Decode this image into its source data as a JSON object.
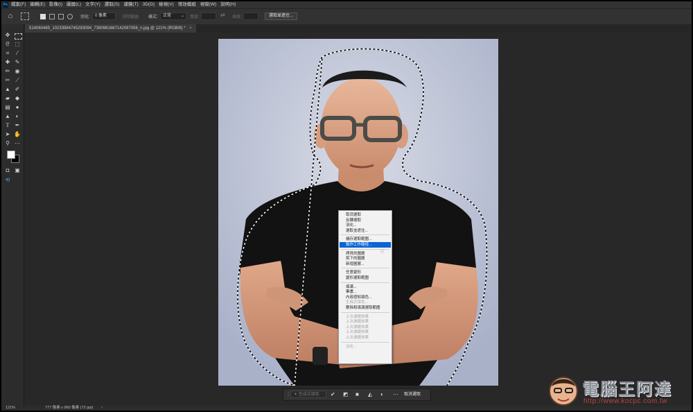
{
  "app": {
    "logo": "Ps",
    "menu": [
      "檔案(F)",
      "編輯(E)",
      "影像(I)",
      "圖層(L)",
      "文字(Y)",
      "選取(S)",
      "濾鏡(T)",
      "3D(D)",
      "檢視(V)",
      "增效模組",
      "視窗(W)",
      "說明(H)"
    ]
  },
  "options": {
    "feather_label": "羽化:",
    "feather_value": "0 像素",
    "antialias_label": "消除鋸齒",
    "style_label": "樣式:",
    "style_value": "正常",
    "width_label": "寬度:",
    "height_label": "高度:",
    "select_mask_button": "選取並遮住..."
  },
  "document": {
    "tab_title": "514060465_10233984745293094_7390961667142087056_n.jpg @ 121% (RGB/8) *"
  },
  "context_menu": {
    "items": [
      {
        "label": "取消選取",
        "disabled": false
      },
      {
        "label": "反轉選取",
        "disabled": false
      },
      {
        "label": "羽化...",
        "disabled": false
      },
      {
        "label": "選取並遮住...",
        "disabled": false
      },
      {
        "sep": true
      },
      {
        "label": "儲存選取範圍...",
        "disabled": false
      },
      {
        "label": "製作工作路徑...",
        "disabled": false,
        "highlighted": true
      },
      {
        "sep": true
      },
      {
        "label": "拷貝的圖層",
        "disabled": false
      },
      {
        "label": "剪下的圖層",
        "disabled": false
      },
      {
        "label": "新增圖層...",
        "disabled": false
      },
      {
        "sep": true
      },
      {
        "label": "任意變形",
        "disabled": false
      },
      {
        "label": "變形選取範圍",
        "disabled": false
      },
      {
        "sep": true
      },
      {
        "label": "填滿...",
        "disabled": false
      },
      {
        "label": "筆畫...",
        "disabled": false
      },
      {
        "label": "內容感知填色...",
        "disabled": false
      },
      {
        "label": "生成式填色...",
        "disabled": true
      },
      {
        "label": "刪除和填滿選取範圍",
        "disabled": false
      },
      {
        "sep": true
      },
      {
        "label": "上次濾鏡效果",
        "disabled": true
      },
      {
        "label": "上次濾鏡效果",
        "disabled": true
      },
      {
        "label": "上次濾鏡效果",
        "disabled": true
      },
      {
        "label": "上次濾鏡效果",
        "disabled": true
      },
      {
        "label": "上次濾鏡效果",
        "disabled": true
      },
      {
        "sep": true
      },
      {
        "label": "淡化...",
        "disabled": true
      }
    ]
  },
  "contextual_taskbar": {
    "generative_fill_label": "生成式填色",
    "deselect_label": "取消選取"
  },
  "status": {
    "zoom": "121%",
    "doc_info": "777 像素 x 960 像素 (72 ppi)"
  },
  "watermark": {
    "title": "電腦王阿達",
    "url": "http://www.kocpc.com.tw"
  },
  "colors": {
    "highlight": "#0a64d6",
    "foreground_swatch": "#ffffff",
    "background_swatch": "#000000",
    "watermark_url": "#b7473f"
  }
}
